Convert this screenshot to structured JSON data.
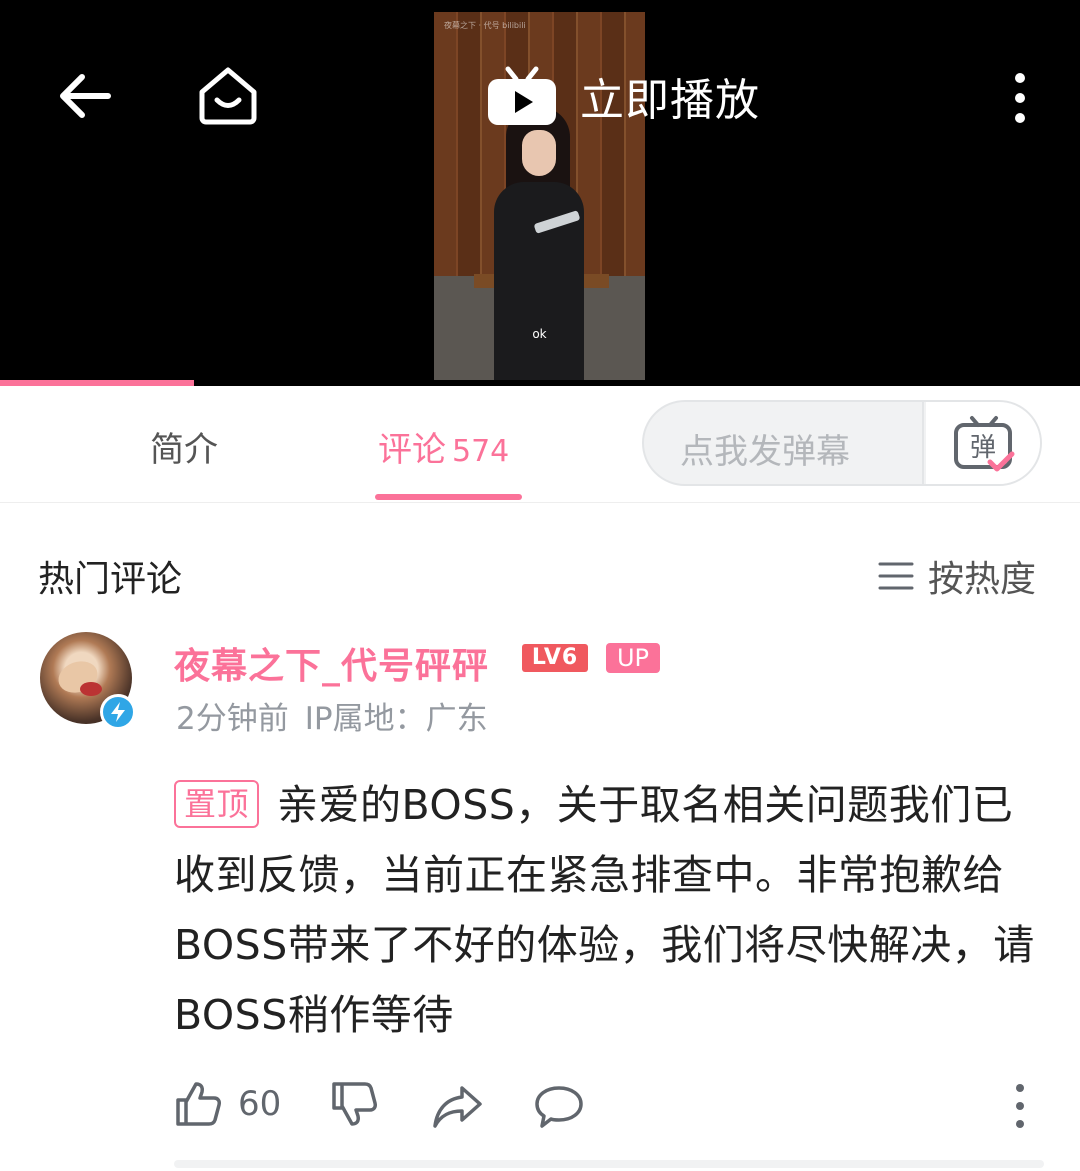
{
  "player": {
    "play_now_label": "立即播放",
    "caption": "ok",
    "watermark": "夜幕之下 · 代号 bilibili",
    "progress_fraction": 0.18
  },
  "tabs": [
    {
      "label": "简介"
    },
    {
      "label": "评论",
      "count": "574",
      "active": true
    }
  ],
  "danmaku": {
    "placeholder": "点我发弹幕",
    "send_icon": "danmaku-icon"
  },
  "comments_section": {
    "title": "热门评论",
    "sort_label": "按热度"
  },
  "comment": {
    "username": "夜幕之下_代号砰砰",
    "level": "LV6",
    "up_badge": "UP",
    "time": "2分钟前",
    "ip_location": "IP属地：广东",
    "pin_label": "置顶",
    "text": "亲爱的BOSS，关于取名相关问题我们已收到反馈，当前正在紧急排查中。非常抱歉给BOSS带来了不好的体验，我们将尽快解决，请BOSS稍作等待",
    "likes": "60"
  },
  "colors": {
    "accent": "#fb7299",
    "level_badge": "#f0595f",
    "verify": "#2fa6e6"
  }
}
